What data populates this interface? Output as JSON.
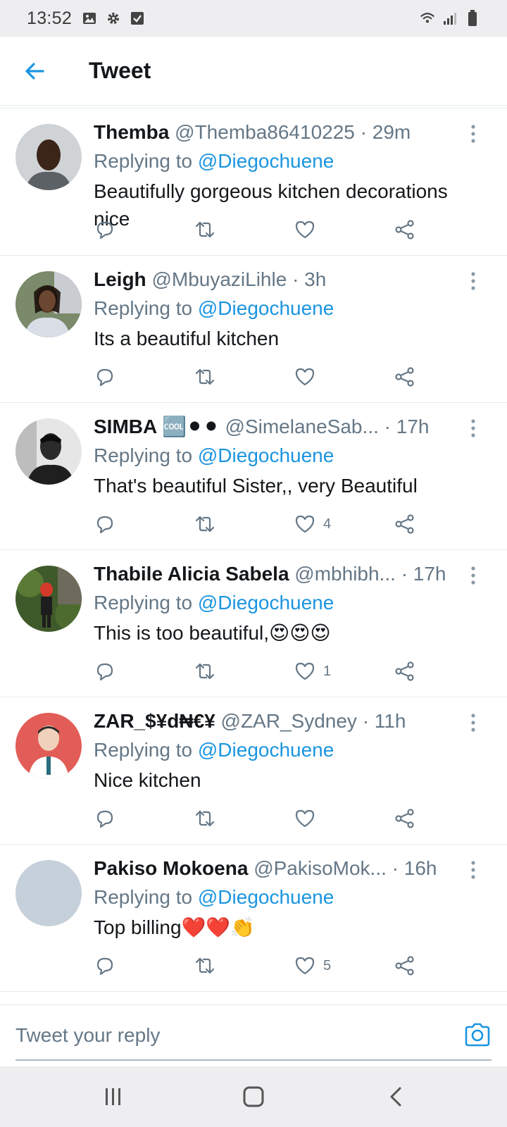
{
  "status_bar": {
    "time": "13:52",
    "left_icons": [
      "image-icon",
      "gear-icon",
      "check-box-icon"
    ],
    "right_icons": [
      "wifi-icon",
      "signal-icon",
      "battery-icon"
    ]
  },
  "header": {
    "title": "Tweet",
    "back_icon": "arrow-left-icon"
  },
  "colors": {
    "accent": "#1b95e0",
    "text": "#14171a",
    "secondary": "#657786"
  },
  "tweets": [
    {
      "name": "Themba",
      "handle": "@Themba86410225",
      "time": "· 29m",
      "replying_label": "Replying to",
      "replying_to": "@Diegochuene",
      "text": "Beautifully gorgeous  kitchen decorations  nice",
      "likes": ""
    },
    {
      "name": "Leigh",
      "handle": "@MbuyaziLihle",
      "time": "· 3h",
      "replying_label": "Replying to",
      "replying_to": "@Diegochuene",
      "text": "Its a beautiful kitchen",
      "likes": ""
    },
    {
      "name": "SIMBA 🆒⚫⚫",
      "handle": "@SimelaneSab...",
      "time": "· 17h",
      "replying_label": "Replying to",
      "replying_to": "@Diegochuene",
      "text": "That's beautiful Sister,, very Beautiful",
      "likes": "4"
    },
    {
      "name": "Thabile Alicia Sabela",
      "handle": "@mbhibh...",
      "time": "· 17h",
      "replying_label": "Replying to",
      "replying_to": "@Diegochuene",
      "text": "This is too beautiful,😍😍😍",
      "likes": "1"
    },
    {
      "name": "ZAR_$¥d₦€¥",
      "handle": "@ZAR_Sydney",
      "time": "· 11h",
      "replying_label": "Replying to",
      "replying_to": "@Diegochuene",
      "text": "Nice kitchen",
      "likes": ""
    },
    {
      "name": "Pakiso Mokoena",
      "handle": "@PakisoMok...",
      "time": "· 16h",
      "replying_label": "Replying to",
      "replying_to": "@Diegochuene",
      "text": "Top billing❤️❤️👏",
      "likes": "5"
    }
  ],
  "reply_bar": {
    "placeholder": "Tweet your reply",
    "camera_icon": "camera-icon"
  },
  "nav_bar": {
    "icons": [
      "recent-apps-icon",
      "home-icon",
      "back-icon"
    ]
  }
}
